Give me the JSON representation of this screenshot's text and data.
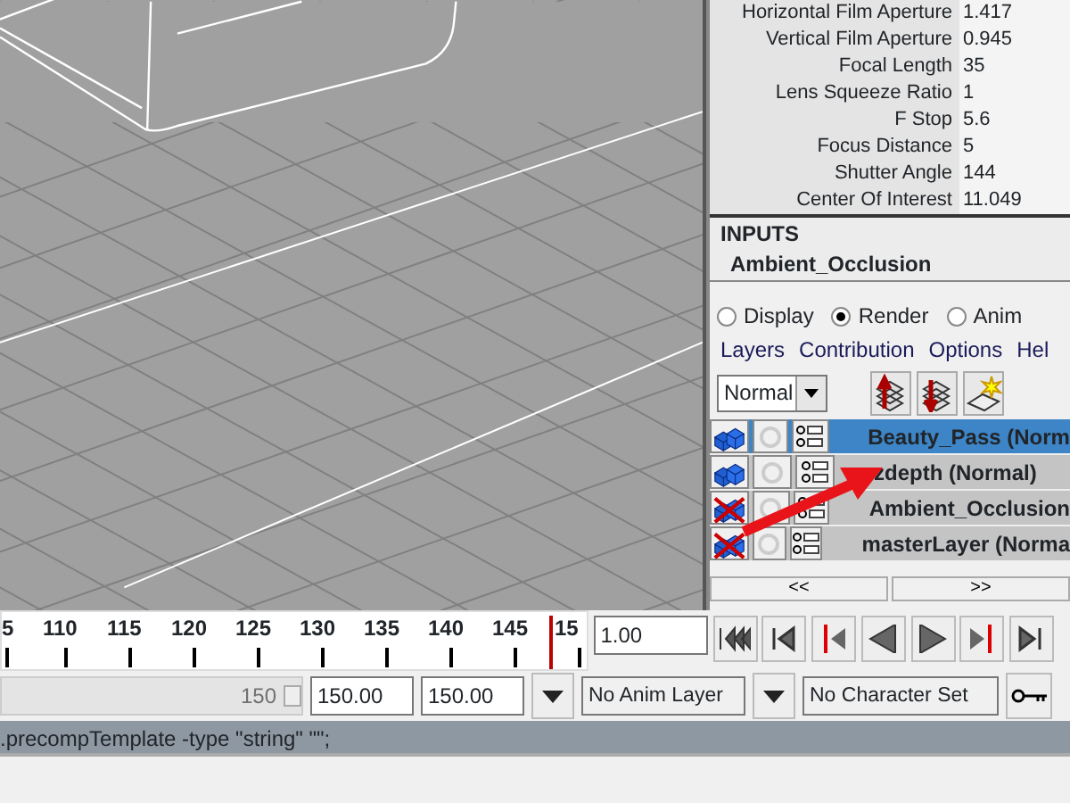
{
  "attributes": [
    {
      "label": "Horizontal Film Aperture",
      "value": "1.417"
    },
    {
      "label": "Vertical Film Aperture",
      "value": "0.945"
    },
    {
      "label": "Focal Length",
      "value": "35"
    },
    {
      "label": "Lens Squeeze Ratio",
      "value": "1"
    },
    {
      "label": "F Stop",
      "value": "5.6"
    },
    {
      "label": "Focus Distance",
      "value": "5"
    },
    {
      "label": "Shutter Angle",
      "value": "144"
    },
    {
      "label": "Center Of Interest",
      "value": "11.049"
    }
  ],
  "inputs": {
    "heading": "INPUTS",
    "items": [
      "Ambient_Occlusion"
    ]
  },
  "layer_editor": {
    "modes": [
      {
        "label": "Display",
        "selected": false
      },
      {
        "label": "Render",
        "selected": true
      },
      {
        "label": "Anim",
        "selected": false
      }
    ],
    "menu": [
      "Layers",
      "Contribution",
      "Options",
      "Hel"
    ],
    "blend_mode": "Normal",
    "layers": [
      {
        "name": "Beauty_Pass (Norm",
        "selected": true,
        "visible": true
      },
      {
        "name": "zdepth (Normal)",
        "selected": false,
        "visible": true
      },
      {
        "name": "Ambient_Occlusion",
        "selected": false,
        "visible": false
      },
      {
        "name": "masterLayer (Norma",
        "selected": false,
        "visible": false
      }
    ],
    "pager": [
      "<<",
      ">>"
    ]
  },
  "timeline": {
    "ticks": [
      "5",
      "110",
      "115",
      "120",
      "125",
      "130",
      "135",
      "140",
      "145",
      "15"
    ],
    "current_frame": "1.00",
    "level": 0.93
  },
  "range": {
    "slider_label": "150",
    "level": 1,
    "start": "150.00",
    "end": "150.00"
  },
  "anim_layer": "No Anim Layer",
  "character_set": "No Character Set",
  "command_output": ".precompTemplate -type \"string\" \"\";"
}
